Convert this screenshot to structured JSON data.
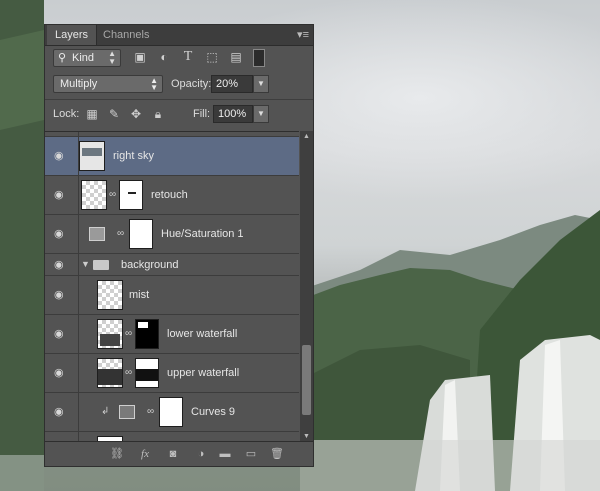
{
  "panel": {
    "tabs": [
      {
        "label": "Layers"
      },
      {
        "label": "Channels"
      }
    ],
    "menu_glyph": "▾≡"
  },
  "filter": {
    "kind_label": "Kind",
    "icons": [
      "image-filter-icon",
      "adjustment-filter-icon",
      "type-filter-icon",
      "shape-filter-icon",
      "smart-object-filter-icon"
    ]
  },
  "blending": {
    "mode": "Multiply",
    "opacity_label": "Opacity:",
    "opacity_value": "20%",
    "lock_label": "Lock:",
    "fill_label": "Fill:",
    "fill_value": "100%"
  },
  "layers": [
    {
      "name": "right sky",
      "selected": true
    },
    {
      "name": "retouch"
    },
    {
      "name": "Hue/Saturation 1"
    },
    {
      "name": "background",
      "type": "group"
    },
    {
      "name": "mist"
    },
    {
      "name": "lower waterfall"
    },
    {
      "name": "upper waterfall"
    },
    {
      "name": "Curves 9"
    }
  ],
  "colors": {
    "panel_bg": "#535353",
    "selected_row": "#5d6b85"
  }
}
